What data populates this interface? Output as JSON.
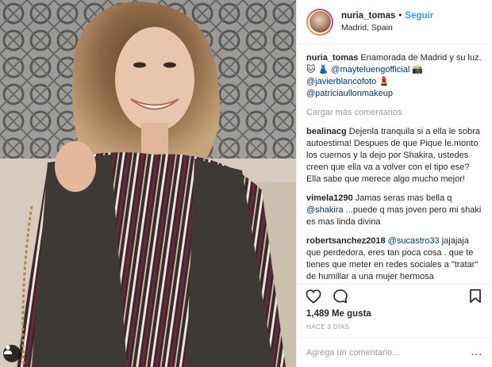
{
  "post": {
    "username": "nuria_tomas",
    "follow_label": "Seguir",
    "header_separator": "•",
    "location": "Madrid, Spain"
  },
  "caption": {
    "username": "nuria_tomas",
    "text": "Enamorada de Madrid y su luz. 🐱",
    "line2_icon": "👗",
    "mention1": "@mayteluengofficial",
    "line2_icon2": "📸",
    "mention2": "@javierblancofoto",
    "line3_icon": "💄",
    "mention3": "@patriciaullonmakeup"
  },
  "load_more_label": "Cargar más comentarios",
  "comments": [
    {
      "user": "bealinacg",
      "text": "Dejenla tranquila si a ella le sobra autoestima! Despues de que Pique le.monto los cuernos y la dejo por Shakira, ustedes creen que ella va a volver con el tipo ese? Ella sabe que merece algo mucho mejor!"
    },
    {
      "user": "vimela1290",
      "text_before": "Jamas seras mas bella q ",
      "mention": "@shakira",
      "text_after": " ...puede q mas joven pero mi shaki es mas linda divina"
    },
    {
      "user": "robertsanchez2018",
      "mention": "@sucastro33",
      "text_after": " jajajaja que perdedora, eres tan poca cosa . que te tienes que meter en redes sociales a \"tratar\" de humillar a una mujer hermosa"
    }
  ],
  "likes_label": "1,489 Me gusta",
  "timestamp": "HACE 3 DÍAS",
  "add_comment_placeholder": "Agrega un comentario...",
  "more_options": "...",
  "colors": {
    "link": "#3897f0",
    "mention": "#003569",
    "muted": "#999999",
    "text": "#262626"
  },
  "icons": [
    "user-tag-icon",
    "heart-icon",
    "comment-icon",
    "bookmark-icon"
  ]
}
